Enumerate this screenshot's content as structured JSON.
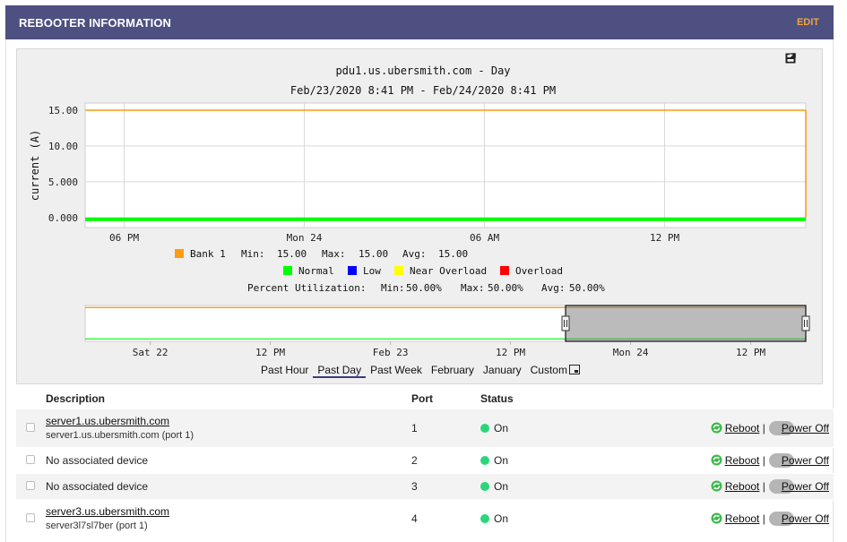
{
  "header": {
    "title": "REBOOTER INFORMATION",
    "edit_label": "EDIT"
  },
  "chart_toolbar": {
    "save_icon": "floppy-save-icon",
    "popout_icon": "external-link-icon"
  },
  "chart_data": [
    {
      "type": "line",
      "title": "pdu1.us.ubersmith.com - Day",
      "subtitle": "Feb/23/2020 8:41 PM - Feb/24/2020 8:41 PM",
      "ylabel": "current (A)",
      "ylim": [
        -1.4,
        16.0
      ],
      "yticks": [
        "15.00",
        "10.00",
        "5.000",
        "0.000"
      ],
      "ytick_values": [
        15,
        10,
        5,
        0
      ],
      "xticks": [
        "06 PM",
        "Mon 24",
        "06 AM",
        "12 PM"
      ],
      "x_hours": [
        0,
        24
      ],
      "xtick_hours": [
        1.3,
        7.3,
        13.3,
        19.3
      ],
      "grid": true,
      "series": [
        {
          "name": "Bank 1",
          "color": "#ff9c12",
          "x": [
            0,
            24
          ],
          "y": [
            15.0,
            15.0
          ]
        }
      ],
      "status_band": {
        "color": "#00ff00",
        "from": -0.5,
        "to": 0.0
      },
      "legend": {
        "series_line": {
          "name": "Bank 1",
          "min_label": "Min:",
          "min": "15.00",
          "max_label": "Max:",
          "max": "15.00",
          "avg_label": "Avg:",
          "avg": "15.00"
        },
        "status": [
          {
            "name": "Normal",
            "color": "#00ff00"
          },
          {
            "name": "Low",
            "color": "#0000ff"
          },
          {
            "name": "Near Overload",
            "color": "#ffff00"
          },
          {
            "name": "Overload",
            "color": "#ff0000"
          }
        ],
        "utilization": {
          "label": "Percent Utilization:",
          "min_label": "Min:",
          "min": "50.00%",
          "max_label": "Max:",
          "max": "50.00%",
          "avg_label": "Avg:",
          "avg": "50.00%"
        }
      }
    },
    {
      "type": "line",
      "title": "",
      "xticks": [
        "Sat 22",
        "12 PM",
        "Feb 23",
        "12 PM",
        "Mon 24",
        "12 PM"
      ],
      "x_hours": [
        0,
        72
      ],
      "xtick_hours": [
        6.5,
        18.5,
        30.5,
        42.5,
        54.5,
        66.5
      ],
      "ylim": [
        -1.4,
        16.0
      ],
      "selection_hours": [
        48,
        72
      ],
      "series": [
        {
          "name": "Bank 1",
          "color": "#ff9c12",
          "x": [
            0,
            72
          ],
          "y": [
            15.0,
            15.0
          ]
        }
      ],
      "status_band": {
        "color": "#00ff00",
        "from": -0.5,
        "to": 0.0
      }
    }
  ],
  "ranges": {
    "items": [
      "Past Hour",
      "Past Day",
      "Past Week",
      "February",
      "January",
      "Custom"
    ],
    "active": "Past Day"
  },
  "table": {
    "headers": {
      "description": "Description",
      "port": "Port",
      "status": "Status"
    },
    "actions": {
      "reboot": "Reboot",
      "sep": "|",
      "power_off": "Power Off"
    },
    "rows": [
      {
        "name": "server1.us.ubersmith.com",
        "sub": "server1.us.ubersmith.com (port 1)",
        "port": "1",
        "status": "On",
        "linked": true
      },
      {
        "name": "No associated device",
        "sub": "",
        "port": "2",
        "status": "On",
        "linked": false
      },
      {
        "name": "No associated device",
        "sub": "",
        "port": "3",
        "status": "On",
        "linked": false
      },
      {
        "name": "server3.us.ubersmith.com",
        "sub": "server3l7sl7ber (port 1)",
        "port": "4",
        "status": "On",
        "linked": true
      }
    ]
  }
}
